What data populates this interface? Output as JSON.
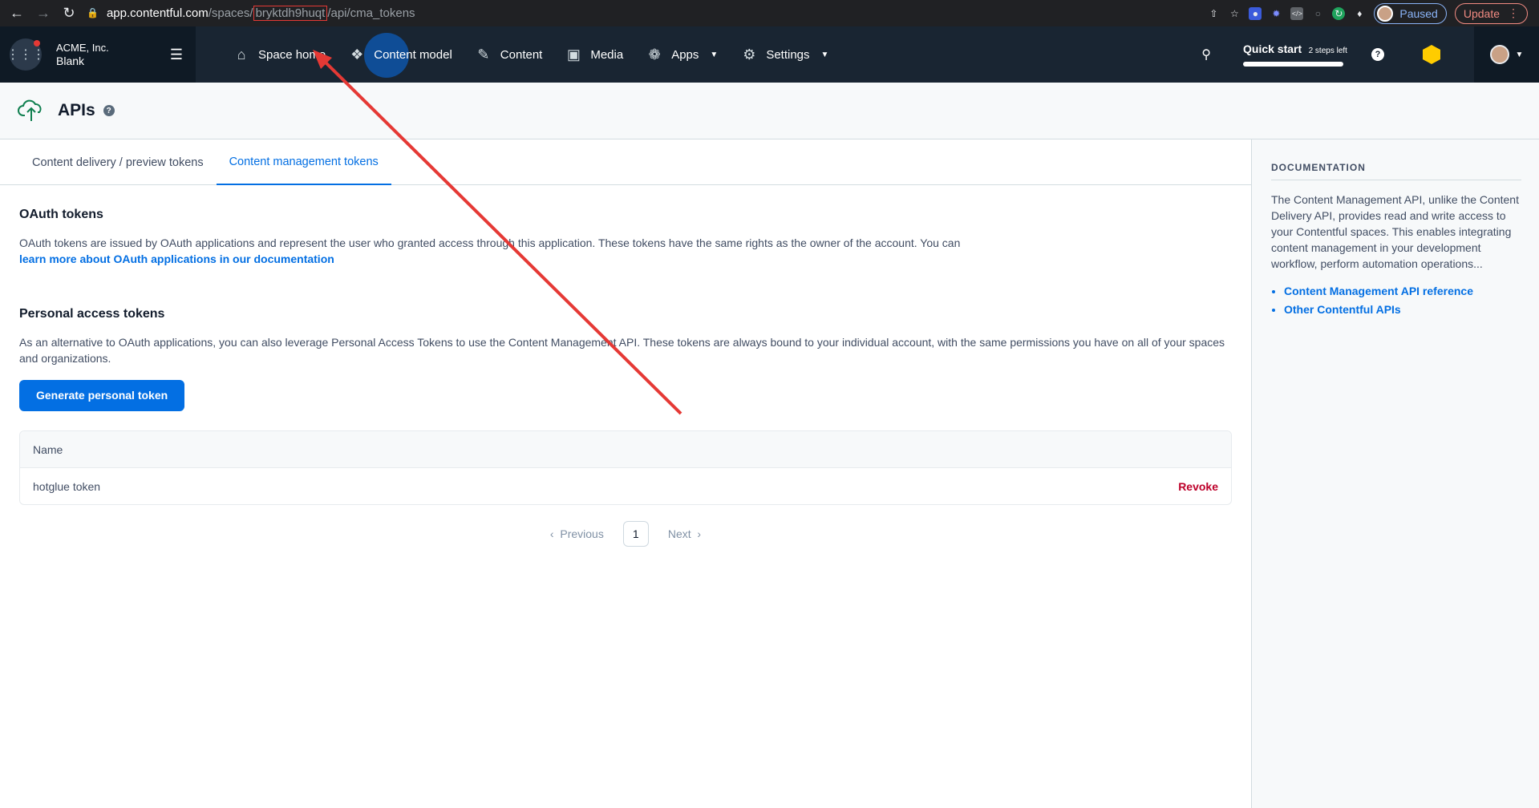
{
  "browser": {
    "url_host": "app.contentful.com",
    "url_path_before": "/spaces/",
    "url_space_id": "bryktdh9huqt",
    "url_path_after": "/api/cma_tokens",
    "paused_label": "Paused",
    "update_label": "Update"
  },
  "nav": {
    "org_name": "ACME, Inc.",
    "space_name": "Blank",
    "items": [
      {
        "label": "Space home",
        "icon": "home-icon"
      },
      {
        "label": "Content model",
        "icon": "content-model-icon"
      },
      {
        "label": "Content",
        "icon": "content-icon"
      },
      {
        "label": "Media",
        "icon": "media-icon"
      },
      {
        "label": "Apps",
        "icon": "apps-icon"
      },
      {
        "label": "Settings",
        "icon": "settings-icon"
      }
    ],
    "quick_start_title": "Quick start",
    "quick_start_steps": "2 steps left",
    "quick_start_progress": 0.95
  },
  "page": {
    "title": "APIs"
  },
  "tabs": [
    {
      "label": "Content delivery / preview tokens",
      "active": false
    },
    {
      "label": "Content management tokens",
      "active": true
    }
  ],
  "oauth": {
    "title": "OAuth tokens",
    "text": "OAuth tokens are issued by OAuth applications and represent the user who granted access through this application. These tokens have the same rights as the owner of the account. You can",
    "link": "learn more about OAuth applications in our documentation"
  },
  "pat": {
    "title": "Personal access tokens",
    "text": "As an alternative to OAuth applications, you can also leverage Personal Access Tokens to use the Content Management API. These tokens are always bound to your individual account, with the same permissions you have on all of your spaces and organizations.",
    "button": "Generate personal token"
  },
  "table": {
    "header": "Name",
    "rows": [
      {
        "name": "hotglue token",
        "action": "Revoke"
      }
    ]
  },
  "pagination": {
    "previous": "Previous",
    "current": "1",
    "next": "Next"
  },
  "sidebar": {
    "heading": "DOCUMENTATION",
    "text": "The Content Management API, unlike the Content Delivery API, provides read and write access to your Contentful spaces. This enables integrating content management in your development workflow, perform automation operations...",
    "links": [
      "Content Management API reference",
      "Other Contentful APIs"
    ]
  },
  "colors": {
    "accent": "#036fe3",
    "nav_bg": "#192532",
    "danger": "#bd002a",
    "annotation": "#e53935"
  }
}
